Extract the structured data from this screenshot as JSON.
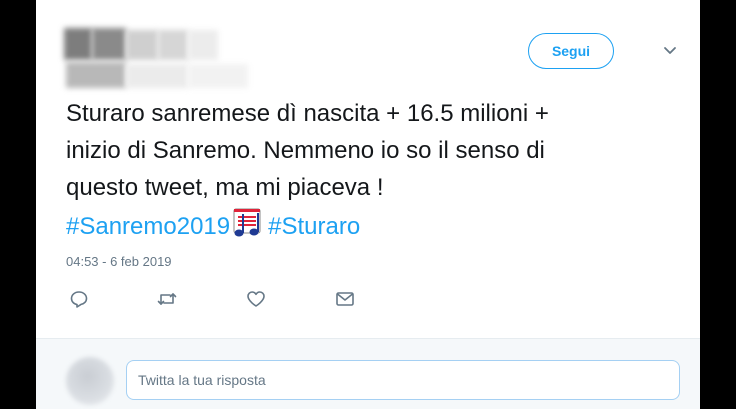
{
  "tweet": {
    "follow_label": "Segui",
    "text_lines": [
      "Sturaro sanremese dì nascita + 16.5 milioni +",
      "inizio di Sanremo. Nemmeno io so il senso di",
      "questo tweet, ma mi piaceva !"
    ],
    "hashtags": [
      "#Sanremo2019",
      "#Sturaro"
    ],
    "emoji_icon": "musical-score-icon",
    "timestamp": "04:53 - 6 feb 2019"
  },
  "actions": [
    "reply-icon",
    "retweet-icon",
    "like-icon",
    "message-icon"
  ],
  "reply": {
    "placeholder": "Twitta la tua risposta"
  },
  "colors": {
    "accent": "#1da1f2",
    "text": "#14171a",
    "muted": "#657786"
  }
}
